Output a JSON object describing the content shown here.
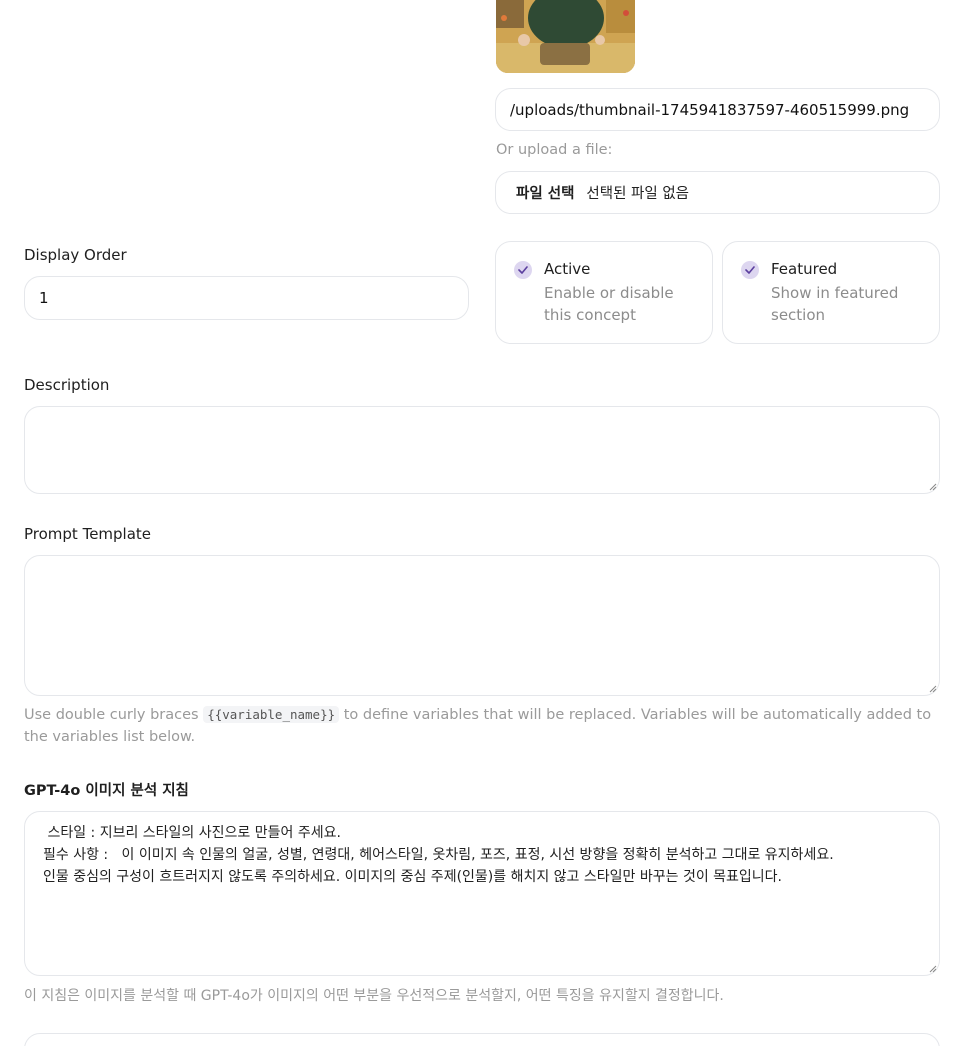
{
  "thumbnail": {
    "icon": "child-photo-thumbnail"
  },
  "image_url": {
    "value": "/uploads/thumbnail-1745941837597-460515999.png"
  },
  "upload": {
    "label": "Or upload a file:",
    "button": "파일 선택",
    "status": "선택된 파일 없음"
  },
  "display_order": {
    "label": "Display Order",
    "value": "1"
  },
  "active": {
    "title": "Active",
    "desc": "Enable or disable this concept",
    "checked": true
  },
  "featured": {
    "title": "Featured",
    "desc": "Show in featured section",
    "checked": true
  },
  "description": {
    "label": "Description",
    "value": ""
  },
  "prompt_template": {
    "label": "Prompt Template",
    "value": "",
    "hint_before": "Use double curly braces ",
    "hint_code": "{{variable_name}}",
    "hint_after": " to define variables that will be replaced. Variables will be automatically added to the variables list below."
  },
  "gpt_instructions": {
    "label": "GPT-4o 이미지 분석 지침",
    "lines": [
      " 스타일 : 지브리 스타일의 사진으로 만들어 주세요.",
      "필수 사항 :   이 이미지 속 인물의 얼굴, 성별, 연령대, 헤어스타일, 옷차림, 포즈, 표정, 시선 방향을 정확히 분석하고 그대로 유지하세요.",
      "인물 중심의 구성이 흐트러지지 않도록 주의하세요. 이미지의 중심 주제(인물)를 해치지 않고 스타일만 바꾸는 것이 목표입니다."
    ],
    "hint": "이 지침은 이미지를 분석할 때 GPT-4o가 이미지의 어떤 부분을 우선적으로 분석할지, 어떤 특징을 유지할지 결정합니다."
  },
  "colors": {
    "check_bg": "#ddd6f0",
    "check_mark": "#5b3f9e",
    "border": "#e5e7eb",
    "muted": "#9a9a9a"
  }
}
